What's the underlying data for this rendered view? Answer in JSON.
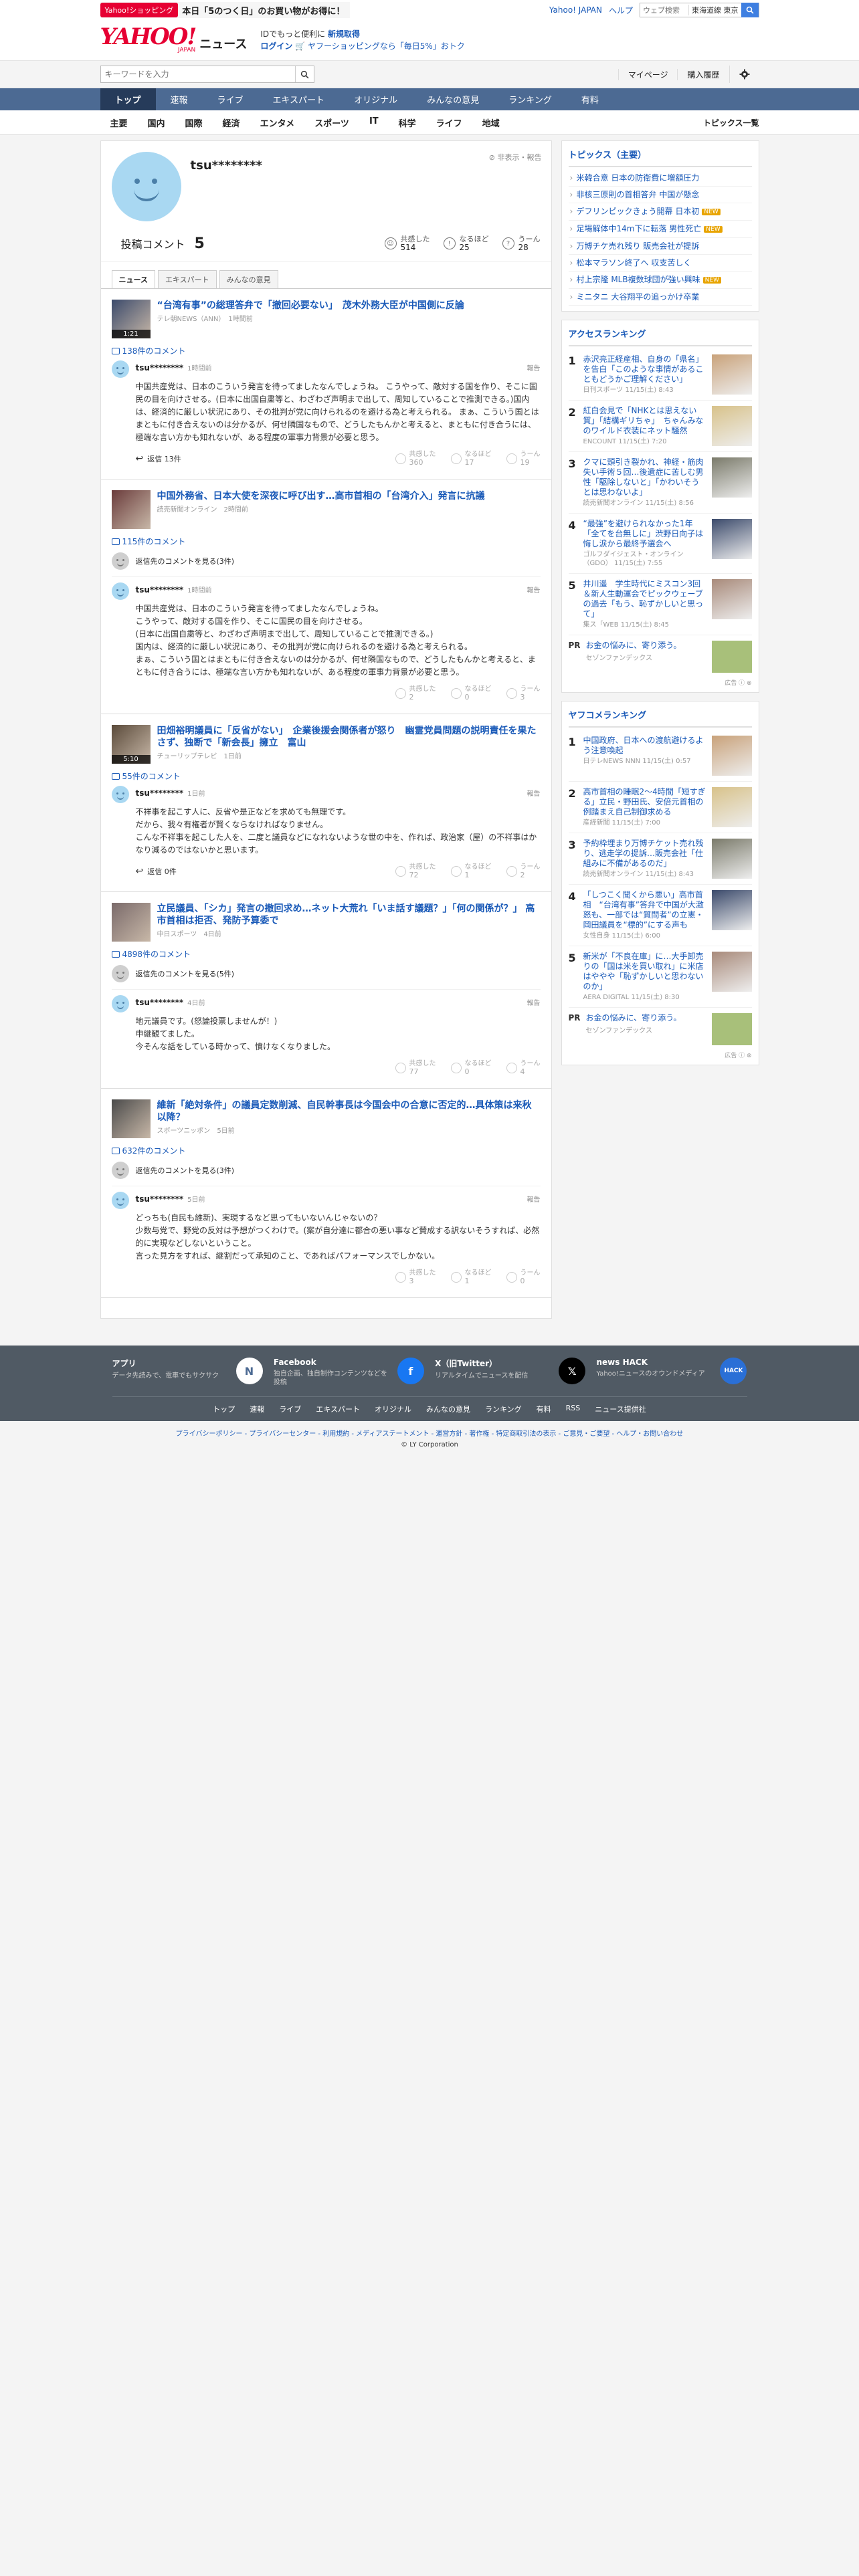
{
  "promo": {
    "badge": "Yahoo!ショッピング",
    "text": "本日「5のつく日」のお買い物がお得に！"
  },
  "top_links": {
    "yahoo_japan": "Yahoo! JAPAN",
    "help": "ヘルプ",
    "search_placeholder": "ウェブ検索",
    "region": "東海道線 東京"
  },
  "header": {
    "logo_text": "YAHOO!",
    "logo_sub": "JAPAN",
    "service": "ニュース",
    "line1_prefix": "IDでもっと便利に",
    "line1_link": "新規取得",
    "login": "ログイン",
    "line2": "ヤフーショッピングなら「毎日5%」おトク"
  },
  "search": {
    "placeholder": "キーワードを入力",
    "mypage": "マイページ",
    "history": "購入履歴"
  },
  "nav": [
    "トップ",
    "速報",
    "ライブ",
    "エキスパート",
    "オリジナル",
    "みんなの意見",
    "ランキング",
    "有料"
  ],
  "subnav": [
    "主要",
    "国内",
    "国際",
    "経済",
    "エンタメ",
    "スポーツ",
    "IT",
    "科学",
    "ライフ",
    "地域"
  ],
  "subnav_all": "トピックス一覧",
  "profile": {
    "name": "tsu********",
    "report": "非表示・報告",
    "post_label": "投稿コメント",
    "post_count": "5",
    "reactions": [
      {
        "label": "共感した",
        "value": "514"
      },
      {
        "label": "なるほど",
        "value": "25"
      },
      {
        "label": "うーん",
        "value": "28"
      }
    ]
  },
  "tabs": [
    "ニュース",
    "エキスパート",
    "みんなの意見"
  ],
  "articles": [
    {
      "title": "“台湾有事”の総理答弁で「撤回必要ない」　茂木外務大臣が中国側に反論",
      "source": "テレ朝NEWS（ANN）",
      "time": "1時間前",
      "duration": "1:21",
      "comment_count": "138件のコメント",
      "has_parent": false,
      "parent_text": "",
      "user": "tsu********",
      "posted": "1時間前",
      "report": "報告",
      "text": "中国共産党は、日本のこういう発言を待ってましたなんでしょうね。 こうやって、敵対する国を作り、そこに国民の目を向けさせる。(日本に出国自粛等と、わざわざ声明まで出して、周知していることで推測できる。)国内は、経済的に厳しい状況にあり、その批判が党に向けられるのを避ける為と考えられる。 まぁ、こういう国とはまともに付き合えないのは分かるが、何せ隣国なもので、どうしたもんかと考えると、まともに付き合うには、極端な言い方かも知れないが、ある程度の軍事力背景が必要と思う。",
      "reply": "返信 13件",
      "reacts": [
        {
          "label": "共感した",
          "value": "360"
        },
        {
          "label": "なるほど",
          "value": "17"
        },
        {
          "label": "うーん",
          "value": "19"
        }
      ]
    },
    {
      "title": "中国外務省、日本大使を深夜に呼び出す…高市首相の「台湾介入」発言に抗議",
      "source": "読売新聞オンライン",
      "time": "2時間前",
      "duration": "",
      "comment_count": "115件のコメント",
      "has_parent": true,
      "parent_text": "返信先のコメントを見る(3件)",
      "user": "tsu********",
      "posted": "1時間前",
      "report": "報告",
      "text": "中国共産党は、日本のこういう発言を待ってましたなんでしょうね。\nこうやって、敵対する国を作り、そこに国民の目を向けさせる。\n(日本に出国自粛等と、わざわざ声明まで出して、周知していることで推測できる。)\n国内は、経済的に厳しい状況にあり、その批判が党に向けられるのを避ける為と考えられる。\nまぁ、こういう国とはまともに付き合えないのは分かるが、何せ隣国なもので、どうしたもんかと考えると、まともに付き合うには、極端な言い方かも知れないが、ある程度の軍事力背景が必要と思う。",
      "reply": "",
      "reacts": [
        {
          "label": "共感した",
          "value": "2"
        },
        {
          "label": "なるほど",
          "value": "0"
        },
        {
          "label": "うーん",
          "value": "3"
        }
      ]
    },
    {
      "title": "田畑裕明議員に「反省がない」　企業後援会関係者が怒り　幽霊党員問題の説明責任を果たさず、独断で「新会長」擁立　富山",
      "source": "チューリップテレビ",
      "time": "1日前",
      "duration": "5:10",
      "comment_count": "55件のコメント",
      "has_parent": false,
      "parent_text": "",
      "user": "tsu********",
      "posted": "1日前",
      "report": "報告",
      "text": "不祥事を起こす人に、反省や是正などを求めても無理です。\nだから、我々有権者が賢くならなければなりません。\nこんな不祥事を起こした人を、二度と議員などになれないような世の中を、作れば、政治家（屋）の不祥事はかなり減るのではないかと思います。",
      "reply": "返信 0件",
      "reacts": [
        {
          "label": "共感した",
          "value": "72"
        },
        {
          "label": "なるほど",
          "value": "1"
        },
        {
          "label": "うーん",
          "value": "2"
        }
      ]
    },
    {
      "title": "立民議員、「シカ」発言の撤回求め…ネット大荒れ「いま話す議題？」「何の関係が？」 高市首相は拒否、発防予算委で",
      "source": "中日スポーツ",
      "time": "4日前",
      "duration": "",
      "comment_count": "4898件のコメント",
      "has_parent": true,
      "parent_text": "返信先のコメントを見る(5件)",
      "user": "tsu********",
      "posted": "4日前",
      "report": "報告",
      "text": "地元議員です。(怒論投票しませんが！)\n申継観てました。\n今そんな話をしている時かって、憤けなくなりました。",
      "reply": "",
      "reacts": [
        {
          "label": "共感した",
          "value": "77"
        },
        {
          "label": "なるほど",
          "value": "0"
        },
        {
          "label": "うーん",
          "value": "4"
        }
      ]
    },
    {
      "title": "維新「絶対条件」の議員定数削減、自民幹事長は今国会中の合意に否定的…具体策は来秋以降？",
      "source": "スポーツニッポン",
      "time": "5日前",
      "duration": "",
      "comment_count": "632件のコメント",
      "has_parent": true,
      "parent_text": "返信先のコメントを見る(3件)",
      "user": "tsu********",
      "posted": "5日前",
      "report": "報告",
      "text": "どっちも(自民も維新)、実現するなど思ってもいないんじゃないの？\n少数与党で、野党の反対は予想がつくわけで。(案が自分達に都合の悪い事など賛成する訳ないそうすれば、必然的に実現などしないということ。\n言った見方をすれば、継割だって承知のこと、であればパフォーマンスでしかない。",
      "reply": "",
      "reacts": [
        {
          "label": "共感した",
          "value": "3"
        },
        {
          "label": "なるほど",
          "value": "1"
        },
        {
          "label": "うーん",
          "value": "0"
        }
      ]
    }
  ],
  "side": {
    "topics_title": "トピックス（主要）",
    "topics": [
      {
        "text": "米韓合意 日本の防衛費に増額圧力",
        "badge": ""
      },
      {
        "text": "非核三原則の首相答弁 中国が懸念",
        "badge": ""
      },
      {
        "text": "デフリンピックきょう開幕 日本初",
        "badge": "NEW"
      },
      {
        "text": "足場解体中14m下に転落 男性死亡",
        "badge": "NEW"
      },
      {
        "text": "万博チケ売れ残り 販売会社が提訴",
        "badge": ""
      },
      {
        "text": "松本マラソン終了へ 収支苦しく",
        "badge": ""
      },
      {
        "text": "村上宗隆 MLB複数球団が強い興味",
        "badge": "NEW"
      },
      {
        "text": "ミニタニ 大谷翔平の追っかけ卒業",
        "badge": ""
      }
    ],
    "access_title": "アクセスランキング",
    "access": [
      {
        "n": "1",
        "title": "赤沢亮正経産相、自身の「県名」を告白「このような事情があることもどうかご理解ください」",
        "meta": "日刊スポーツ 11/15(土) 8:43"
      },
      {
        "n": "2",
        "title": "紅白会見で「NHKとは思えない質」「結構ギリちゃ」　ちゃんみなのワイルド衣装にネット騒然",
        "meta": "ENCOUNT 11/15(土) 7:20"
      },
      {
        "n": "3",
        "title": "クマに頭引き裂かれ、神経・筋肉失い手術５回…後遺症に苦しむ男性「駆除しないと」「かわいそうとは思わないよ」",
        "meta": "読売新聞オンライン 11/15(土) 8:56"
      },
      {
        "n": "4",
        "title": "“最強”を避けられなかった1年「全てを台無しに」渋野日向子は悔し涙から最終予選会へ",
        "meta": "ゴルフダイジェスト・オンライン（GDO） 11/15(土) 7:55"
      },
      {
        "n": "5",
        "title": "井川遥　学生時代にミスコン3回＆新人生動運会でピックウェーブの過去「もう、恥ずかしいと思って」",
        "meta": "集ス「WEB 11/15(土) 8:45"
      }
    ],
    "pr1": {
      "tag": "PR",
      "title": "お金の悩みに、寄り添う。",
      "meta": "セゾンファンデックス"
    },
    "ad": "広告",
    "yafoo_title": "ヤフコメランキング",
    "yafoo": [
      {
        "n": "1",
        "title": "中国政府、日本への渡航避けるよう注意喚起",
        "meta": "日テレNEWS NNN 11/15(土) 0:57"
      },
      {
        "n": "2",
        "title": "高市首相の睡眠2〜4時間「短すぎる」立民・野田氏、安倍元首相の例踏まえ自己制御求める",
        "meta": "産経新聞 11/15(土) 7:00"
      },
      {
        "n": "3",
        "title": "予約枠埋まり万博チケット売れ残り、逃走学の提訴…販売会社「仕組みに不備があるのだ」",
        "meta": "読売新聞オンライン 11/15(土) 8:43"
      },
      {
        "n": "4",
        "title": "「しつこく聞くから悪い」高市首相　“台湾有事”答弁で中国が大激怒も、一部では“質問者”の立憲・岡田議員を“標的”にする声も",
        "meta": "女性自身 11/15(土) 6:00"
      },
      {
        "n": "5",
        "title": "新米が「不良在庫」に…大手卸売りの「国は米を買い取れ」に米店はややや「恥ずかしいと思わないのか」",
        "meta": "AERA DIGITAL 11/15(土) 8:30"
      }
    ],
    "pr2": {
      "tag": "PR",
      "title": "お金の悩みに、寄り添う。",
      "meta": "セゾンファンデックス"
    }
  },
  "footer": {
    "apps": [
      {
        "title": "アプリ",
        "desc": "データ先読みで、電車でもサクサク",
        "icon": "app-icon"
      },
      {
        "title": "Facebook",
        "desc": "独自企画、独自制作コンテンツなどを投稿",
        "icon": "facebook-icon"
      },
      {
        "title": "X（旧Twitter）",
        "desc": "リアルタイムでニュースを配信",
        "icon": "x-icon"
      },
      {
        "title": "news HACK",
        "desc": "Yahoo!ニュースのオウンドメディア",
        "icon": "newshack-icon"
      }
    ],
    "nav": [
      "トップ",
      "速報",
      "ライブ",
      "エキスパート",
      "オリジナル",
      "みんなの意見",
      "ランキング",
      "有料",
      "RSS",
      "ニュース提供社"
    ],
    "legal": "プライバシーポリシー - プライバシーセンター - 利用規約 - メディアステートメント - 運営方針 - 著作権 - 特定商取引法の表示 - ご意見・ご要望 - ヘルプ・お問い合わせ",
    "copyright": "© LY Corporation"
  },
  "colors": {
    "brand": "#e60033",
    "link": "#1a5ab8",
    "nav_bg": "#4c6a93",
    "nav_active": "#263b5a",
    "footer_bg": "#505a64"
  }
}
